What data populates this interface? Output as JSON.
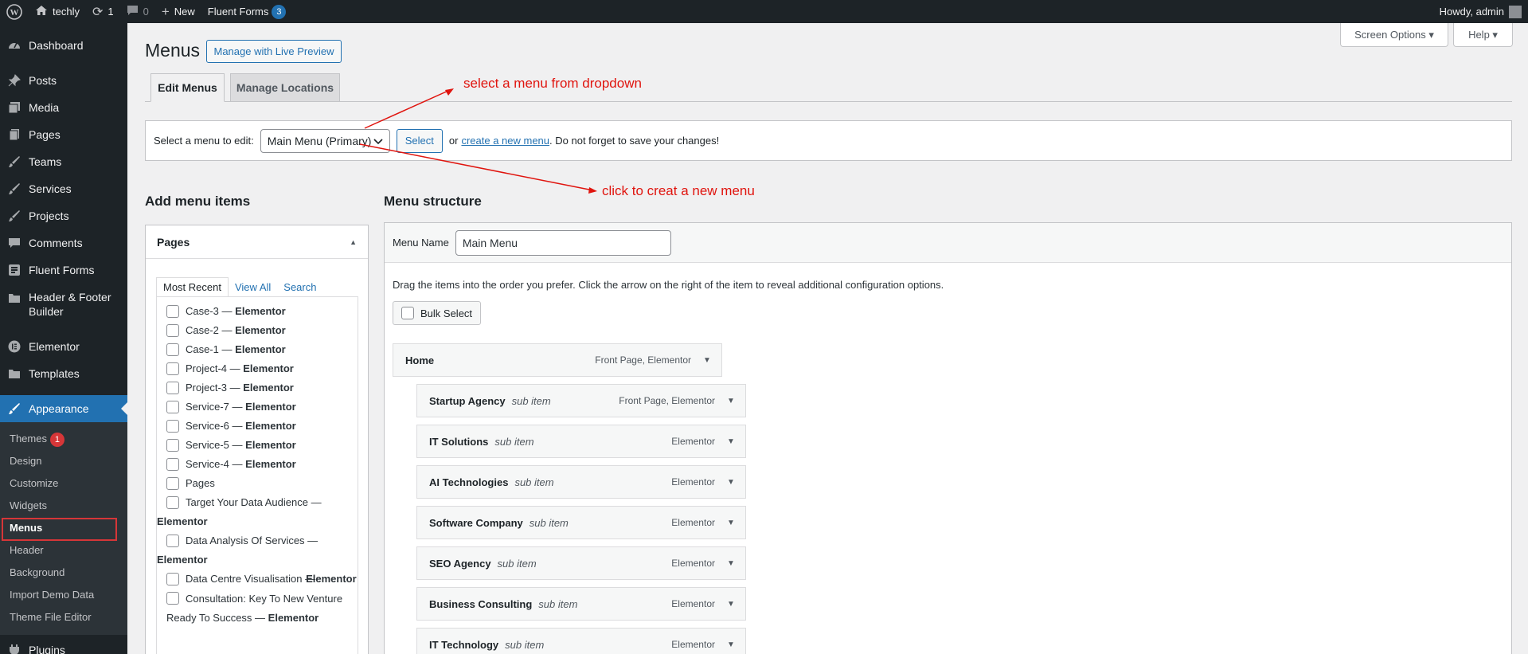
{
  "adminbar": {
    "site_name": "techly",
    "updates": "1",
    "comments": "0",
    "new_label": "New",
    "forms_label": "Fluent Forms",
    "forms_count": "3",
    "howdy": "Howdy, admin"
  },
  "sidebar": {
    "items": [
      {
        "label": "Dashboard",
        "icon": "dashboard-icon"
      },
      {
        "label": "Posts",
        "icon": "pin-icon"
      },
      {
        "label": "Media",
        "icon": "media-icon"
      },
      {
        "label": "Pages",
        "icon": "pages-icon"
      },
      {
        "label": "Teams",
        "icon": "brush-icon"
      },
      {
        "label": "Services",
        "icon": "brush-icon"
      },
      {
        "label": "Projects",
        "icon": "brush-icon"
      },
      {
        "label": "Comments",
        "icon": "comment-icon"
      },
      {
        "label": "Fluent Forms",
        "icon": "forms-icon"
      },
      {
        "label": "Header & Footer Builder",
        "icon": "folder-icon"
      },
      {
        "label": "Elementor",
        "icon": "elementor-icon"
      },
      {
        "label": "Templates",
        "icon": "folder-icon"
      },
      {
        "label": "Appearance",
        "icon": "brush-icon"
      },
      {
        "label": "Plugins",
        "icon": "plugin-icon"
      }
    ],
    "appearance_sub": [
      {
        "label": "Themes",
        "badge": "1"
      },
      {
        "label": "Design"
      },
      {
        "label": "Customize"
      },
      {
        "label": "Widgets"
      },
      {
        "label": "Menus"
      },
      {
        "label": "Header"
      },
      {
        "label": "Background"
      },
      {
        "label": "Import Demo Data"
      },
      {
        "label": "Theme File Editor"
      }
    ]
  },
  "header": {
    "title": "Menus",
    "live_preview": "Manage with Live Preview",
    "screen_options": "Screen Options ▾",
    "help": "Help ▾",
    "tabs": [
      "Edit Menus",
      "Manage Locations"
    ]
  },
  "manage": {
    "select_label": "Select a menu to edit:",
    "selected_menu": "Main Menu (Primary)",
    "select_button": "Select",
    "or": "or",
    "create_link": "create a new menu",
    "reminder": ". Do not forget to save your changes!"
  },
  "annotations": {
    "dropdown": "select a menu from dropdown",
    "create": "click to creat a new menu"
  },
  "add_items": {
    "heading": "Add menu items",
    "panel_title": "Pages",
    "tabs": [
      "Most Recent",
      "View All",
      "Search"
    ],
    "pages": [
      {
        "name": "Case-3",
        "suffix": "Elementor"
      },
      {
        "name": "Case-2",
        "suffix": "Elementor"
      },
      {
        "name": "Case-1",
        "suffix": "Elementor"
      },
      {
        "name": "Project-4",
        "suffix": "Elementor"
      },
      {
        "name": "Project-3",
        "suffix": "Elementor"
      },
      {
        "name": "Service-7",
        "suffix": "Elementor"
      },
      {
        "name": "Service-6",
        "suffix": "Elementor"
      },
      {
        "name": "Service-5",
        "suffix": "Elementor"
      },
      {
        "name": "Service-4",
        "suffix": "Elementor"
      },
      {
        "name": "Pages",
        "suffix": ""
      },
      {
        "name": "Target Your Data Audience",
        "suffix": "Elementor"
      },
      {
        "name": "Data Analysis Of Services",
        "suffix": "Elementor"
      },
      {
        "name": "Data Centre Visualisation",
        "suffix": "Elementor"
      },
      {
        "name": "Consultation: Key To New Venture Ready To Success",
        "suffix": "Elementor"
      }
    ]
  },
  "structure": {
    "heading": "Menu structure",
    "name_label": "Menu Name",
    "name_value": "Main Menu",
    "description": "Drag the items into the order you prefer. Click the arrow on the right of the item to reveal additional configuration options.",
    "bulk_select": "Bulk Select",
    "items": [
      {
        "title": "Home",
        "sub": "",
        "meta": "Front Page, Elementor"
      },
      {
        "title": "Startup Agency",
        "sub": "sub item",
        "meta": "Front Page, Elementor"
      },
      {
        "title": "IT Solutions",
        "sub": "sub item",
        "meta": "Elementor"
      },
      {
        "title": "AI Technologies",
        "sub": "sub item",
        "meta": "Elementor"
      },
      {
        "title": "Software Company",
        "sub": "sub item",
        "meta": "Elementor"
      },
      {
        "title": "SEO Agency",
        "sub": "sub item",
        "meta": "Elementor"
      },
      {
        "title": "Business Consulting",
        "sub": "sub item",
        "meta": "Elementor"
      },
      {
        "title": "IT Technology",
        "sub": "sub item",
        "meta": "Elementor"
      }
    ]
  },
  "colors": {
    "accent": "#2271b1",
    "admin_dark": "#1d2327",
    "annotation_red": "#e0140e"
  }
}
